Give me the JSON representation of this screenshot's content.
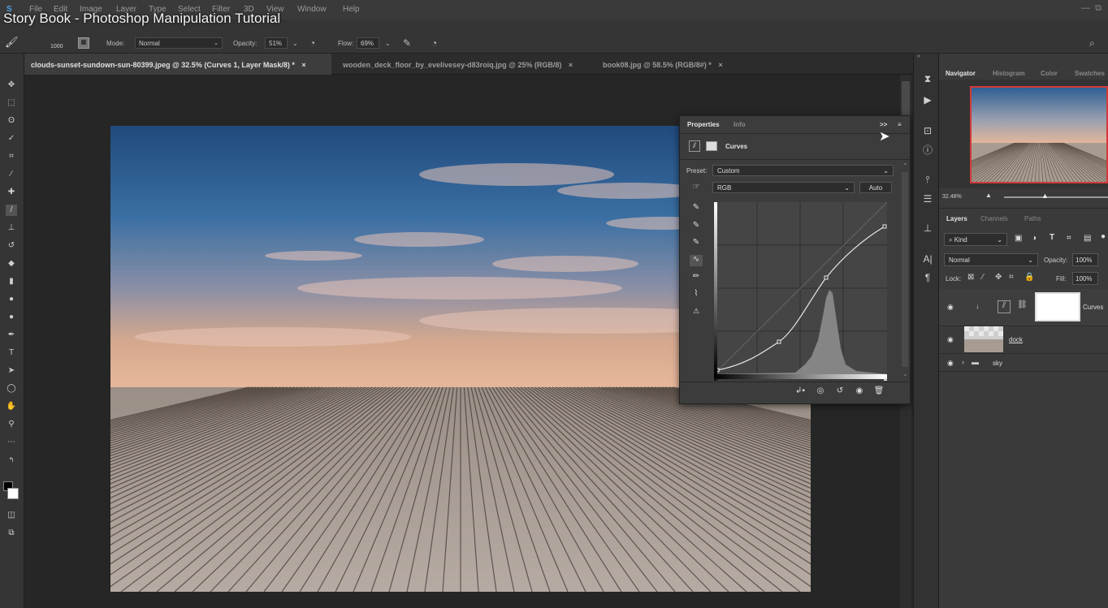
{
  "video_title": "Story Book - Photoshop Manipulation Tutorial",
  "menu": [
    "File",
    "Edit",
    "Image",
    "Layer",
    "Type",
    "Select",
    "Filter",
    "3D",
    "View",
    "Window",
    "Help"
  ],
  "options": {
    "brush_size": "1000",
    "mode_label": "Mode:",
    "mode_value": "Normal",
    "opacity_label": "Opacity:",
    "opacity_value": "51%",
    "flow_label": "Flow:",
    "flow_value": "69%"
  },
  "tabs": [
    {
      "label": "clouds-sunset-sundown-sun-80399.jpeg @ 32.5% (Curves 1, Layer Mask/8) *",
      "close": "×"
    },
    {
      "label": "wooden_deck_floor_by_evelivesey-d83roiq.jpg @ 25% (RGB/8)",
      "close": "×"
    },
    {
      "label": "book08.jpg @ 58.5% (RGB/8#) *",
      "close": "×"
    }
  ],
  "properties": {
    "tab_properties": "Properties",
    "tab_info": "Info",
    "adjustment_name": "Curves",
    "preset_label": "Preset:",
    "preset_value": "Custom",
    "channel_value": "RGB",
    "auto_label": "Auto",
    "expand_label": ">>"
  },
  "right_panel": {
    "tabs": [
      "Navigator",
      "Histogram",
      "Color",
      "Swatches"
    ],
    "zoom": "32.48%",
    "layers_tabs": [
      "Layers",
      "Channels",
      "Paths"
    ],
    "kind_label": "Kind",
    "blend_mode": "Normal",
    "opacity_label": "Opacity:",
    "opacity_value": "100%",
    "lock_label": "Lock:",
    "fill_label": "Fill:",
    "fill_value": "100%"
  },
  "layers": [
    {
      "name": "Curves"
    },
    {
      "name": "dock"
    },
    {
      "name": "sky"
    }
  ],
  "colors": {
    "accent_red": "#d23a3a",
    "sky_top": "#2b5c92",
    "sky_horizon": "#e0b49a",
    "deck": "#a89c92"
  }
}
